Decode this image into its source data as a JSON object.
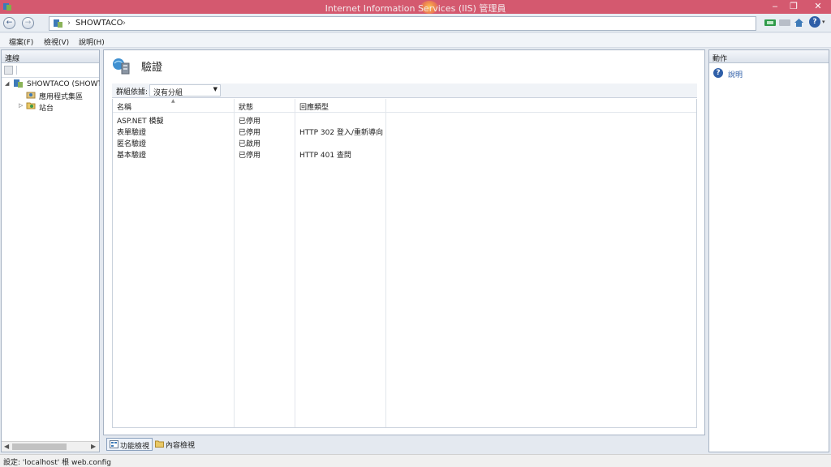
{
  "window": {
    "title": "Internet Information Services (IIS) 管理員",
    "minimize": "‒",
    "restore": "❐",
    "close": "✕"
  },
  "nav": {
    "back": "←",
    "forward": "→",
    "crumbs": [
      "SHOWTACO",
      "›"
    ],
    "help_glyph": "?"
  },
  "menu": {
    "file": "檔案(F)",
    "view": "檢視(V)",
    "help": "說明(H)"
  },
  "connections": {
    "header": "連線",
    "tree": {
      "root": "SHOWTACO (SHOWTACO\\...",
      "app_pools": "應用程式集區",
      "sites": "站台"
    }
  },
  "main": {
    "title": "驗證",
    "group_by_label": "群組依據:",
    "group_by_value": "沒有分組",
    "columns": [
      "名稱",
      "狀態",
      "回應類型"
    ],
    "rows": [
      {
        "name": "ASP.NET 模擬",
        "status": "已停用",
        "response": ""
      },
      {
        "name": "表單驗證",
        "status": "已停用",
        "response": "HTTP 302 登入/重新導向"
      },
      {
        "name": "匿名驗證",
        "status": "已啟用",
        "response": ""
      },
      {
        "name": "基本驗證",
        "status": "已停用",
        "response": "HTTP 401 查問"
      }
    ],
    "tabs": {
      "features": "功能檢視",
      "content": "內容檢視"
    }
  },
  "actions": {
    "header": "動作",
    "help": "說明"
  },
  "status": {
    "text": "設定: 'localhost' 根 web.config"
  },
  "colors": {
    "titlebar": "#d4596f",
    "link": "#2f5fa8"
  }
}
